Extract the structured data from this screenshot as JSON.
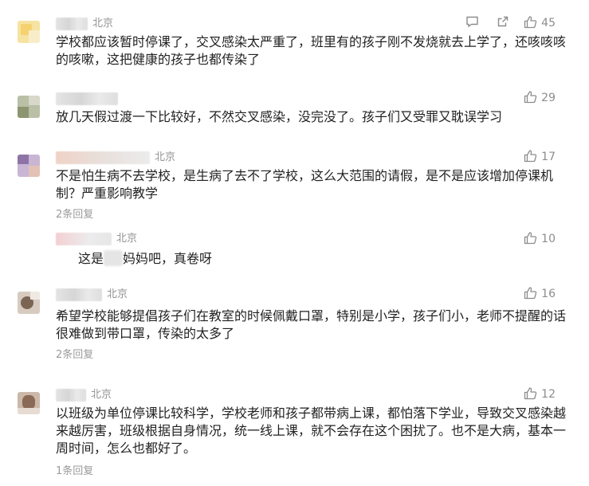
{
  "comments": [
    {
      "location": "北京",
      "text": "学校都应该暂时停课了，交叉感染太严重了，班里有的孩子刚不发烧就去上学了，还咳咳咳的咳嗽，这把健康的孩子也都传染了",
      "likes": "45",
      "has_reply_share": true
    },
    {
      "location": "",
      "text": "放几天假过渡一下比较好，不然交叉感染，没完没了。孩子们又受罪又耽误学习",
      "likes": "29"
    },
    {
      "location": "北京",
      "text": "不是怕生病不去学校，是生病了去不了学校，这么大范围的请假，是不是应该增加停课机制？严重影响教学",
      "likes": "17",
      "replies_label": "2条回复",
      "sub_reply": {
        "location": "北京",
        "text_before": "这是",
        "text_after": "妈妈吧，真卷呀",
        "likes": "10"
      }
    },
    {
      "location": "北京",
      "text": "希望学校能够提倡孩子们在教室的时候佩戴口罩，特别是小学，孩子们小，老师不提醒的话很难做到带口罩，传染的太多了",
      "likes": "16",
      "replies_label": "2条回复"
    },
    {
      "location": "北京",
      "text": "以班级为单位停课比较科学，学校老师和孩子都带病上课，都怕落下学业，导致交叉感染越来越厉害，班级根据自身情况，统一线上课，就不会存在这个困扰了。也不是大病，基本一周时间，怎么也都好了。",
      "likes": "12",
      "replies_label": "1条回复"
    }
  ],
  "icons": {
    "like": "thumbs-up-icon",
    "reply": "comment-bubble-icon",
    "share": "share-icon"
  },
  "colors": {
    "meta_text": "#939393",
    "body_text": "#222222",
    "icon": "#8c8c8c"
  }
}
